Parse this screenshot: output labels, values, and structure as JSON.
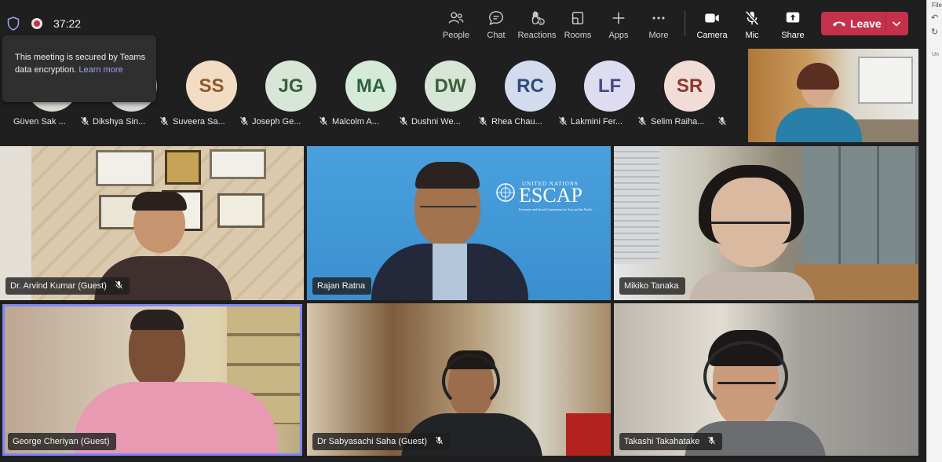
{
  "meeting": {
    "timer": "37:22",
    "security_tooltip": "This meeting is secured by Teams data encryption.",
    "learn_more": "Learn more"
  },
  "toolbar": {
    "people": "People",
    "chat": "Chat",
    "reactions": "Reactions",
    "rooms": "Rooms",
    "apps": "Apps",
    "more": "More",
    "camera": "Camera",
    "mic": "Mic",
    "share": "Share",
    "leave": "Leave"
  },
  "attendees": [
    {
      "name": "Güven Sak ...",
      "initials": "",
      "color": "#dcd9d3"
    },
    {
      "name": "Dikshya Sin...",
      "initials": "",
      "color": "#d6d6d6"
    },
    {
      "name": "Suveera Sa...",
      "initials": "SS",
      "color": "#f3dcc4"
    },
    {
      "name": "Joseph Ge...",
      "initials": "JG",
      "color": "#d8e6d8"
    },
    {
      "name": "Malcolm A...",
      "initials": "MA",
      "color": "#d6ead8"
    },
    {
      "name": "Dushni We...",
      "initials": "DW",
      "color": "#d8e6d8"
    },
    {
      "name": "Rhea Chau...",
      "initials": "RC",
      "color": "#d2dcee"
    },
    {
      "name": "Lakmini Fer...",
      "initials": "LF",
      "color": "#dedcf0"
    },
    {
      "name": "Selim Raiha...",
      "initials": "SR",
      "color": "#f1dcd6"
    }
  ],
  "tiles": [
    {
      "name": "Dr. Arvind Kumar (Guest)",
      "muted": true
    },
    {
      "name": "Rajan Ratna",
      "muted": false
    },
    {
      "name": "Mikiko Tanaka",
      "muted": false
    },
    {
      "name": "George Cheriyan (Guest)",
      "muted": false
    },
    {
      "name": "Dr Sabyasachi Saha (Guest)",
      "muted": true
    },
    {
      "name": "Takashi Takahatake",
      "muted": true
    }
  ],
  "escap": {
    "un": "UNITED NATIONS",
    "name": "ESCAP",
    "sub": "Economic and Social Commission for Asia and the Pacific"
  },
  "edge": {
    "text": "File",
    "text2": "Un"
  },
  "colors": {
    "leave": "#c4314b",
    "active_border": "#7f85f5",
    "background": "#1f1f1f"
  }
}
